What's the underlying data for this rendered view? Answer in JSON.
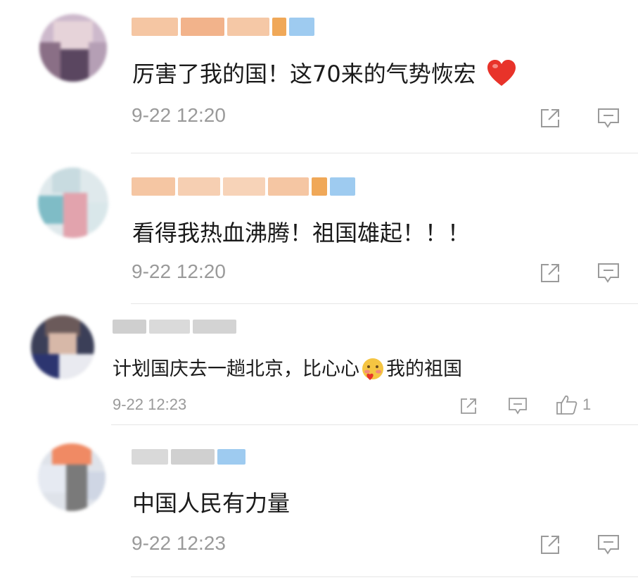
{
  "comments": [
    {
      "text": "厉害了我的国！这70来的气势恢宏",
      "emoji": "red-heart",
      "time": "9-22 12:20",
      "likes": ""
    },
    {
      "text": "看得我热血沸腾！祖国雄起！！！",
      "time": "9-22 12:20",
      "likes": ""
    },
    {
      "text_before_emoji": "计划国庆去一趟北京，比心心",
      "emoji": "blush-face",
      "text_after_emoji": "我的祖国",
      "time": "9-22 12:23",
      "likes": "1"
    },
    {
      "text": "中国人民有力量",
      "time": "9-22 12:23",
      "likes": ""
    }
  ],
  "colors": {
    "time_gray": "#9a9a9a",
    "heart_red": "#e8332a",
    "divider": "#e6e6e6",
    "username_orange": "#f3b48a",
    "vip_blue": "#9ecbf0"
  }
}
